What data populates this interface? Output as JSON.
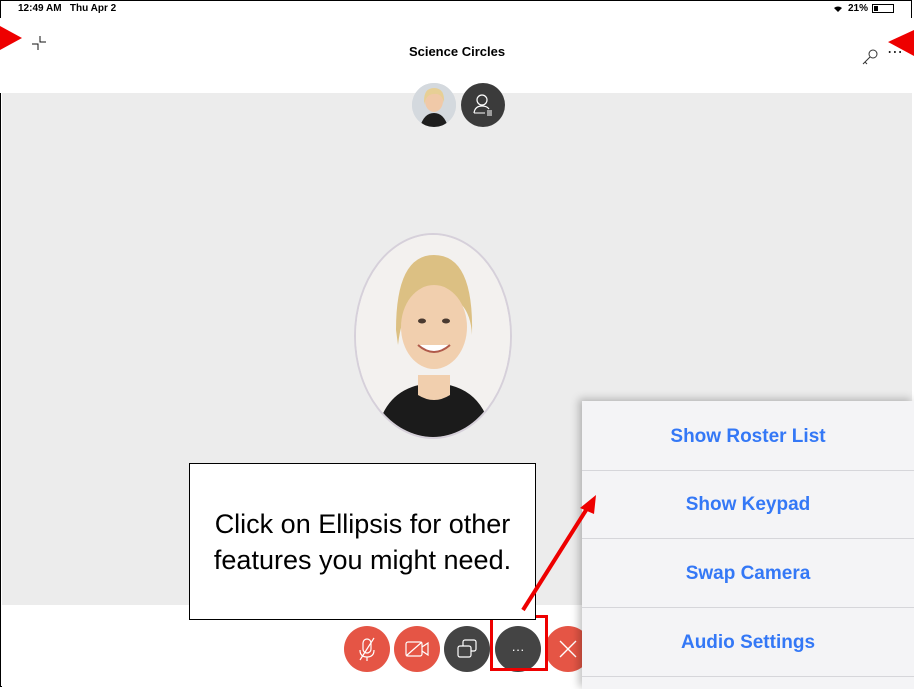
{
  "status": {
    "time": "12:49 AM",
    "date": "Thu Apr 2",
    "battery": "21%"
  },
  "header": {
    "title": "Science Circles"
  },
  "callout": {
    "text": "Click on Ellipsis for other features you might need."
  },
  "menu": {
    "items": [
      {
        "label": "Show Roster List"
      },
      {
        "label": "Show Keypad"
      },
      {
        "label": "Swap Camera"
      },
      {
        "label": "Audio Settings"
      }
    ]
  },
  "controls": {
    "more_label": "···"
  },
  "colors": {
    "accent_blue": "#3478f6",
    "control_red": "#e55545",
    "control_dark": "#444444",
    "annotation_red": "#e00000"
  }
}
